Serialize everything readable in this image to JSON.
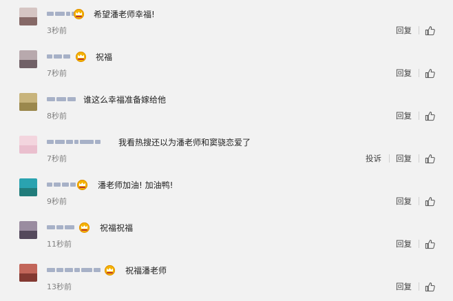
{
  "actions": {
    "reply": "回复",
    "report": "投诉"
  },
  "colors": {
    "background": "#f2f2f2",
    "crown": "#f4b400",
    "username_mosaic": "#9aa6bf",
    "text": "#222222",
    "time": "#808080"
  },
  "comments": [
    {
      "text": "希望潘老师幸福!",
      "time": "3秒前",
      "badge": true,
      "avatar": [
        "#d5c5c3",
        "#6b4a48"
      ]
    },
    {
      "text": "祝福",
      "time": "7秒前",
      "badge": true,
      "avatar": [
        "#b8a9ad",
        "#5a4a50"
      ]
    },
    {
      "text": "谁这么幸福准备嫁给他",
      "time": "8秒前",
      "badge": false,
      "avatar": [
        "#c8b47c",
        "#8c7a3d"
      ]
    },
    {
      "text": "我看热搜还以为潘老师和窦骁恋爱了",
      "time": "7秒前",
      "badge": false,
      "avatar": [
        "#f3d5de",
        "#e7b7c8"
      ],
      "report": true
    },
    {
      "text": "潘老师加油! 加油鸭!",
      "time": "9秒前",
      "badge": true,
      "avatar": [
        "#2aa3b0",
        "#1f6f6a"
      ]
    },
    {
      "text": "祝福祝福",
      "time": "11秒前",
      "badge": true,
      "avatar": [
        "#9a8ca0",
        "#3c3346"
      ]
    },
    {
      "text": "祝福潘老师",
      "time": "13秒前",
      "badge": true,
      "avatar": [
        "#c2665a",
        "#6e2b25"
      ]
    }
  ],
  "icons": {
    "like": "thumbs-up-icon",
    "badge": "crown-badge-icon"
  }
}
